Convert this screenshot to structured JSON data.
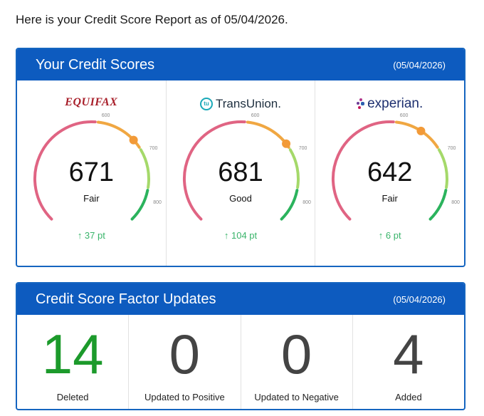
{
  "intro_text": "Here is your Credit Score Report as of 05/04/2026.",
  "scores_panel": {
    "title": "Your Credit Scores",
    "date": "(05/04/2026)",
    "gauge_ticks": [
      "600",
      "700",
      "800"
    ],
    "bureaus": [
      {
        "name": "EQUIFAX",
        "score": "671",
        "rating": "Fair",
        "change": "↑ 37 pt",
        "score_number": 671
      },
      {
        "name": "TransUnion.",
        "score": "681",
        "rating": "Good",
        "change": "↑ 104 pt",
        "score_number": 681
      },
      {
        "name": "experian.",
        "score": "642",
        "rating": "Fair",
        "change": "↑ 6 pt",
        "score_number": 642
      }
    ]
  },
  "factors_panel": {
    "title": "Credit Score Factor Updates",
    "date": "(05/04/2026)",
    "factors": [
      {
        "value": "14",
        "label": "Deleted"
      },
      {
        "value": "0",
        "label": "Updated to Positive"
      },
      {
        "value": "0",
        "label": "Updated to Negative"
      },
      {
        "value": "4",
        "label": "Added"
      }
    ]
  },
  "colors": {
    "header_blue": "#0d5bbf",
    "gauge_red": "#e06483",
    "gauge_orange": "#f0a742",
    "gauge_lightgreen": "#a5d96a",
    "gauge_green": "#2bb35d",
    "marker": "#f29a38",
    "change_green": "#39b46a",
    "deleted_green": "#1c9a2b"
  }
}
